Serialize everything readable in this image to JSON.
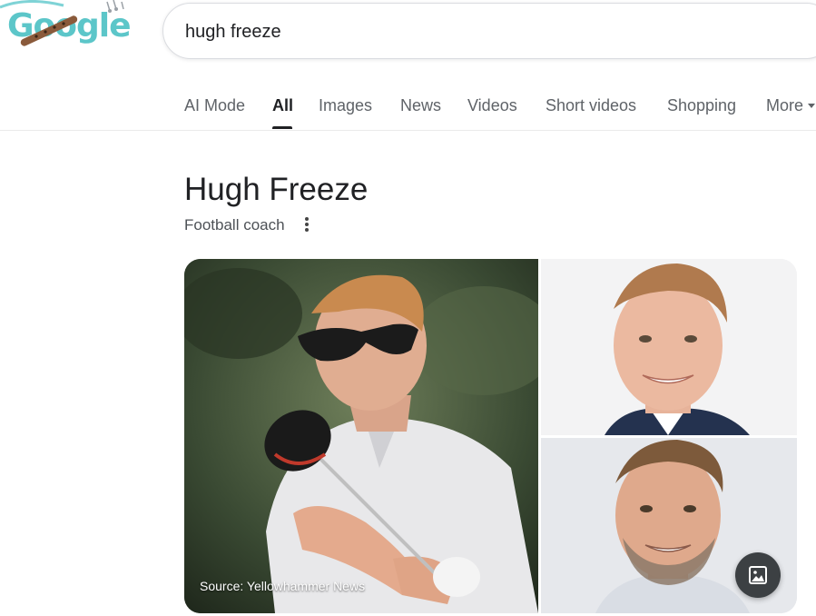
{
  "logo": {
    "text": "Google"
  },
  "search": {
    "query": "hugh freeze"
  },
  "tabs": [
    {
      "label": "AI Mode",
      "active": false
    },
    {
      "label": "All",
      "active": true
    },
    {
      "label": "Images",
      "active": false
    },
    {
      "label": "News",
      "active": false
    },
    {
      "label": "Videos",
      "active": false
    },
    {
      "label": "Short videos",
      "active": false
    },
    {
      "label": "Shopping",
      "active": false
    },
    {
      "label": "More",
      "active": false
    }
  ],
  "knowledge_panel": {
    "title": "Hugh Freeze",
    "subtitle": "Football coach",
    "main_image_source": "Source: Yellowhammer News",
    "images_button_icon": "image-icon",
    "menu_icon": "more-vert-icon"
  },
  "colors": {
    "logo": "#5cc6c9",
    "active_tab": "#202124",
    "inactive_tab": "#5f6368"
  }
}
